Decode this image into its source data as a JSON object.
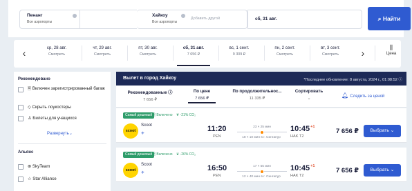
{
  "search": {
    "from_city": "Пенанг",
    "from_sub": "Все аэропорты",
    "to_city": "Хайкоу",
    "to_sub": "Все аэропорты",
    "add_other": "Добавить другой",
    "date": "сб, 31 авг.",
    "find_label": "Найти"
  },
  "dates": [
    {
      "day": "ср, 28 авг.",
      "price": "Смотреть"
    },
    {
      "day": "чт, 29 авг.",
      "price": "Смотреть"
    },
    {
      "day": "пт, 30 авг.",
      "price": "Смотреть"
    },
    {
      "day": "сб, 31 авг.",
      "price": "7 656 ₽"
    },
    {
      "day": "вс, 1 сент.",
      "price": "9 309 ₽"
    },
    {
      "day": "пн, 2 сент.",
      "price": "Смотреть"
    },
    {
      "day": "вт, 3 сент.",
      "price": "Смотреть"
    }
  ],
  "price_chart_label": "Цена",
  "sidebar": {
    "recommended_title": "Рекомендовано",
    "options": [
      "Включен зарегистрированный багаж",
      "Скрыть лоукостеры",
      "Билеты для учащихся"
    ],
    "expand": "Развернуть",
    "alliance_title": "Альянс",
    "alliances": [
      "SkyTeam",
      "Star Alliance"
    ]
  },
  "results": {
    "title": "Вылет в город Хайкоу",
    "updated": "*Последнее обновление: 8 августа, 2024 г., 01:08:52",
    "sort": [
      {
        "label": "Рекомендованные ⓘ",
        "value": "7 656 ₽"
      },
      {
        "label": "По цене",
        "value": "7 656 ₽"
      },
      {
        "label": "По продолжительнос...",
        "value": "11 335 ₽"
      },
      {
        "label": "Сортировать",
        "value": "⌄"
      }
    ],
    "track": "Следить за ценой",
    "flights": [
      {
        "badge": "Самый дешевый",
        "included": "Включено",
        "co2": "-21% CO₂",
        "airline": "Scoot",
        "dep_time": "11:20",
        "dep_code": "PEN",
        "duration": "23 ч 25 мин",
        "stops": "18 ч 10 мин в г. Сингапур",
        "arr_time": "10:45",
        "arr_plus": "+1",
        "arr_code": "HAK T2",
        "price": "7 656 ₽",
        "choose": "Выбрать ⌄"
      },
      {
        "badge": "Самый дешевый",
        "included": "Включено",
        "co2": "-26% CO₂",
        "airline": "Scoot",
        "dep_time": "16:50",
        "dep_code": "PEN",
        "duration": "17 ч 55 мин",
        "stops": "12 ч 40 мин в г. Сингапур",
        "arr_time": "10:45",
        "arr_plus": "+1",
        "arr_code": "HAK T2",
        "price": "7 656 ₽",
        "choose": "Выбрать ⌄"
      }
    ]
  }
}
